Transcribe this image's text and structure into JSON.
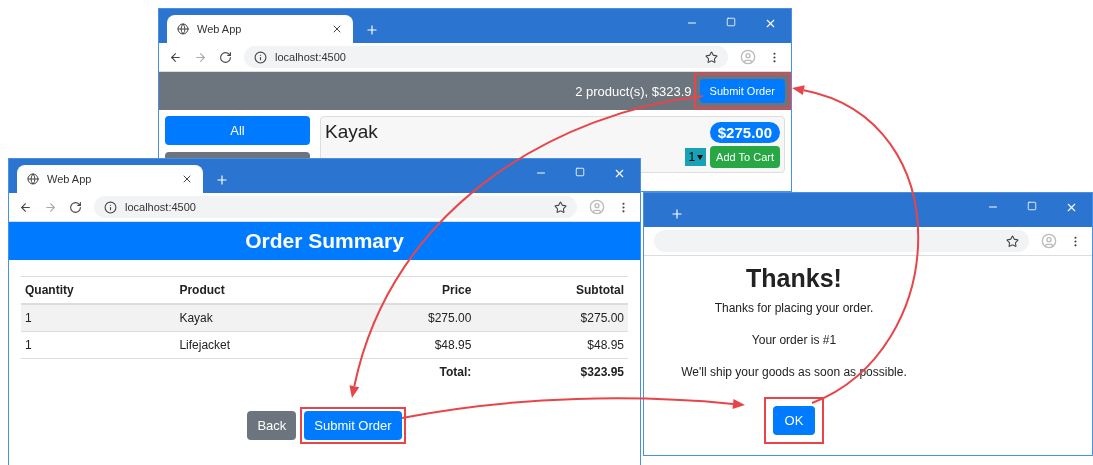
{
  "top_window": {
    "tab_title": "Web App",
    "url": "localhost:4500",
    "summary": "2 product(s), $323.9",
    "submit_button": {
      "label": "Submit Order",
      "highlighted": true
    },
    "categories": [
      {
        "label": "All",
        "selected": true
      },
      {
        "selected": false
      }
    ],
    "product": {
      "name": "Kayak",
      "price": "$275.00",
      "quantity": "1",
      "button": "Add To Cart"
    }
  },
  "summary_window": {
    "tab_title": "Web App",
    "url": "localhost:4500",
    "heading": "Order Summary",
    "columns": [
      "Quantity",
      "Product",
      "Price",
      "Subtotal"
    ],
    "rows": [
      [
        "1",
        "Kayak",
        "$275.00",
        "$275.00"
      ],
      [
        "1",
        "Lifejacket",
        "$48.95",
        "$48.95"
      ]
    ],
    "total": {
      "label": "Total:",
      "value": "$323.95"
    },
    "buttons": [
      {
        "label": "Back",
        "kind": "secondary",
        "highlighted": false
      },
      {
        "label": "Submit Order",
        "kind": "primary",
        "highlighted": true
      }
    ]
  },
  "thanks_window": {
    "heading": "Thanks!",
    "paragraphs": [
      "Thanks for placing your order.",
      "Your order is #1",
      "We'll ship your goods as soon as possible."
    ],
    "button": {
      "label": "OK",
      "highlighted": true
    }
  }
}
